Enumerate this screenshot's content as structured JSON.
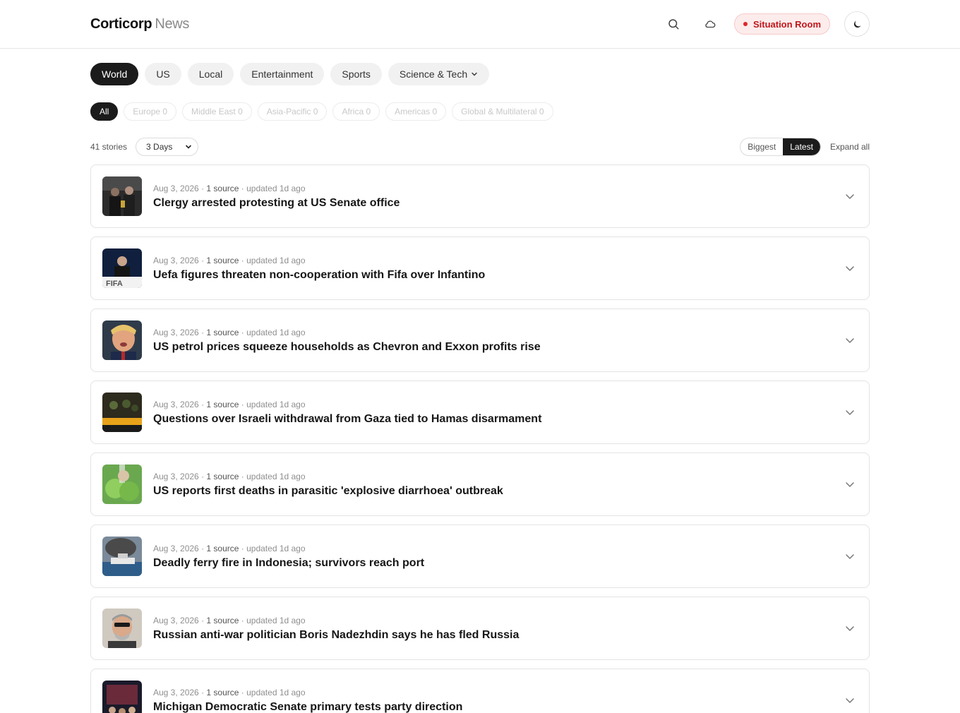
{
  "header": {
    "brand": "Corticorp",
    "brand_sub": "News",
    "situation_label": "Situation Room"
  },
  "colors": {
    "accent_red": "#e0262b",
    "active_pill": "#1b1b1b"
  },
  "tabs": [
    {
      "label": "World",
      "active": true
    },
    {
      "label": "US",
      "active": false
    },
    {
      "label": "Local",
      "active": false
    },
    {
      "label": "Entertainment",
      "active": false
    },
    {
      "label": "Sports",
      "active": false
    },
    {
      "label": "Science & Tech",
      "active": false,
      "dropdown": true
    }
  ],
  "regions": [
    {
      "label": "All",
      "active": true
    },
    {
      "label": "Europe 0",
      "active": false
    },
    {
      "label": "Middle East 0",
      "active": false
    },
    {
      "label": "Asia-Pacific 0",
      "active": false
    },
    {
      "label": "Africa 0",
      "active": false
    },
    {
      "label": "Americas 0",
      "active": false
    },
    {
      "label": "Global & Multilateral 0",
      "active": false
    }
  ],
  "toolbar": {
    "stories_count": "41 stories",
    "range": "3 Days",
    "sort_biggest": "Biggest",
    "sort_latest": "Latest",
    "expand_all": "Expand all"
  },
  "stories": [
    {
      "date": "Aug 3, 2026",
      "source": "1 source",
      "updated": "updated 1d ago",
      "headline": "Clergy arrested protesting at US Senate office"
    },
    {
      "date": "Aug 3, 2026",
      "source": "1 source",
      "updated": "updated 1d ago",
      "headline": "Uefa figures threaten non-cooperation with Fifa over Infantino"
    },
    {
      "date": "Aug 3, 2026",
      "source": "1 source",
      "updated": "updated 1d ago",
      "headline": "US petrol prices squeeze households as Chevron and Exxon profits rise"
    },
    {
      "date": "Aug 3, 2026",
      "source": "1 source",
      "updated": "updated 1d ago",
      "headline": "Questions over Israeli withdrawal from Gaza tied to Hamas disarmament"
    },
    {
      "date": "Aug 3, 2026",
      "source": "1 source",
      "updated": "updated 1d ago",
      "headline": "US reports first deaths in parasitic 'explosive diarrhoea' outbreak"
    },
    {
      "date": "Aug 3, 2026",
      "source": "1 source",
      "updated": "updated 1d ago",
      "headline": "Deadly ferry fire in Indonesia; survivors reach port"
    },
    {
      "date": "Aug 3, 2026",
      "source": "1 source",
      "updated": "updated 1d ago",
      "headline": "Russian anti-war politician Boris Nadezhdin says he has fled Russia"
    },
    {
      "date": "Aug 3, 2026",
      "source": "1 source",
      "updated": "updated 1d ago",
      "headline": "Michigan Democratic Senate primary tests party direction"
    }
  ]
}
